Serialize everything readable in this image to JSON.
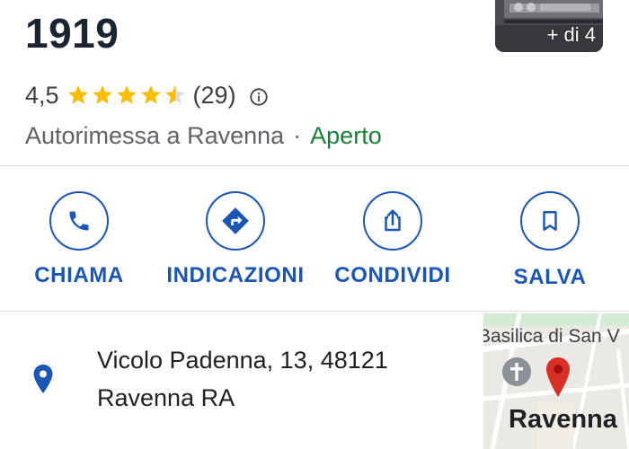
{
  "header": {
    "title_fragment": "1919",
    "photo_count_label": "+ di 4"
  },
  "rating": {
    "score": "4,5",
    "stars": 4.5,
    "review_count": "(29)"
  },
  "place": {
    "category": "Autorimessa a Ravenna",
    "separator": "·",
    "status": "Aperto",
    "status_color": "#188038"
  },
  "actions": [
    {
      "label": "CHIAMA",
      "icon": "phone-icon"
    },
    {
      "label": "INDICAZIONI",
      "icon": "directions-icon"
    },
    {
      "label": "CONDIVIDI",
      "icon": "share-icon"
    },
    {
      "label": "SALVA",
      "icon": "bookmark-icon"
    }
  ],
  "address": {
    "line1": "Vicolo Padenna, 13, 48121",
    "line2": "Ravenna RA",
    "icon": "location-pin-icon"
  },
  "map": {
    "landmark_label": "Basilica di San V",
    "city_label": "Ravenna",
    "pin_color": "#d93025"
  },
  "colors": {
    "accent": "#1a56b5",
    "star": "#fbbc04",
    "title": "#1b2433"
  }
}
